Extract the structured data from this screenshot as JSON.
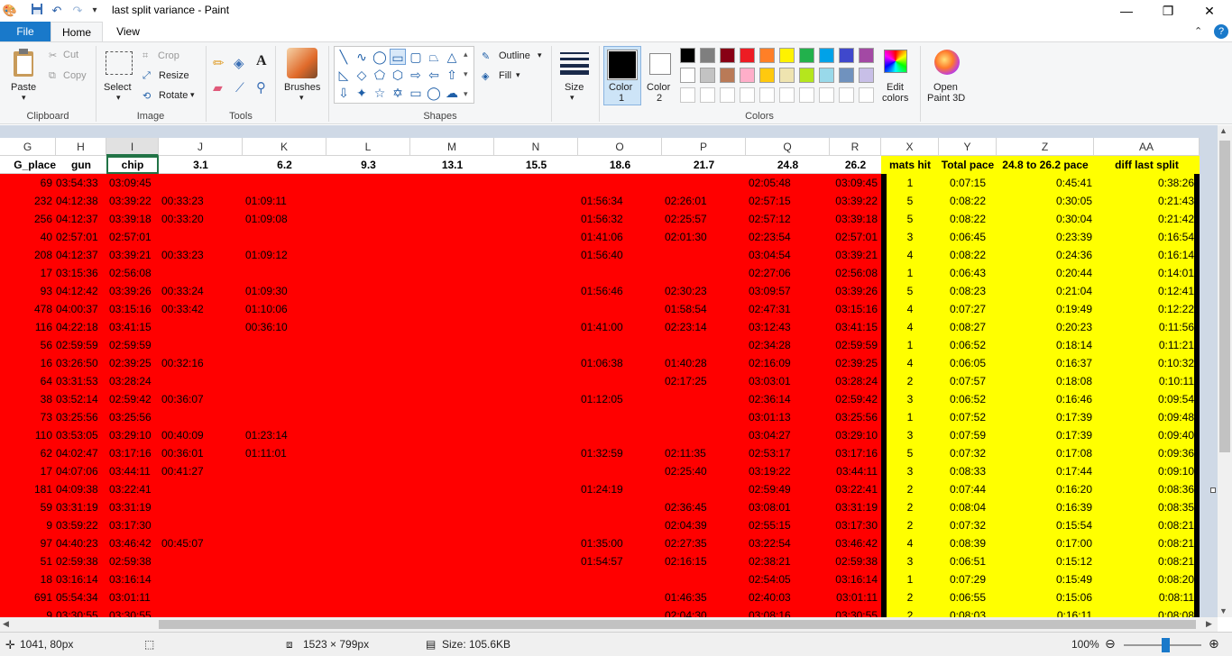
{
  "window": {
    "title": "last split variance - Paint"
  },
  "tabs": {
    "file": "File",
    "home": "Home",
    "view": "View"
  },
  "ribbon": {
    "clipboard": {
      "paste": "Paste",
      "cut": "Cut",
      "copy": "Copy",
      "group": "Clipboard"
    },
    "image": {
      "select": "Select",
      "crop": "Crop",
      "resize": "Resize",
      "rotate": "Rotate",
      "group": "Image"
    },
    "tools": {
      "group": "Tools"
    },
    "brushes": {
      "label": "Brushes"
    },
    "shapes": {
      "outline": "Outline",
      "fill": "Fill",
      "group": "Shapes"
    },
    "size": {
      "label": "Size"
    },
    "colors": {
      "color1_a": "Color",
      "color1_b": "1",
      "color2_a": "Color",
      "color2_b": "2",
      "edit_a": "Edit",
      "edit_b": "colors",
      "group": "Colors",
      "palette_row1": [
        "#000000",
        "#7f7f7f",
        "#880015",
        "#ed1c24",
        "#ff7f27",
        "#fff200",
        "#22b14c",
        "#00a2e8",
        "#3f48cc",
        "#a349a4"
      ],
      "palette_row2": [
        "#ffffff",
        "#c3c3c3",
        "#b97a57",
        "#ffaec9",
        "#ffc90e",
        "#efe4b0",
        "#b5e61d",
        "#99d9ea",
        "#7092be",
        "#c8bfe7"
      ]
    },
    "paint3d": {
      "a": "Open",
      "b": "Paint 3D"
    }
  },
  "sheet": {
    "columns": [
      "G",
      "H",
      "I",
      "J",
      "K",
      "L",
      "M",
      "N",
      "O",
      "P",
      "Q",
      "R",
      "X",
      "Y",
      "Z",
      "AA"
    ],
    "headers": [
      "G_place",
      "gun",
      "chip",
      "3.1",
      "6.2",
      "9.3",
      "13.1",
      "15.5",
      "18.6",
      "21.7",
      "24.8",
      "26.2",
      "mats hit",
      "Total pace",
      "24.8 to 26.2 pace",
      "diff last split"
    ],
    "rows": [
      [
        "69",
        "03:54:33",
        "03:09:45",
        "",
        "",
        "",
        "",
        "",
        "",
        "",
        "02:05:48",
        "03:09:45",
        "1",
        "0:07:15",
        "0:45:41",
        "0:38:26"
      ],
      [
        "232",
        "04:12:38",
        "03:39:22",
        "00:33:23",
        "01:09:11",
        "",
        "",
        "",
        "01:56:34",
        "02:26:01",
        "02:57:15",
        "03:39:22",
        "5",
        "0:08:22",
        "0:30:05",
        "0:21:43"
      ],
      [
        "256",
        "04:12:37",
        "03:39:18",
        "00:33:20",
        "01:09:08",
        "",
        "",
        "",
        "01:56:32",
        "02:25:57",
        "02:57:12",
        "03:39:18",
        "5",
        "0:08:22",
        "0:30:04",
        "0:21:42"
      ],
      [
        "40",
        "02:57:01",
        "02:57:01",
        "",
        "",
        "",
        "",
        "",
        "01:41:06",
        "02:01:30",
        "02:23:54",
        "02:57:01",
        "3",
        "0:06:45",
        "0:23:39",
        "0:16:54"
      ],
      [
        "208",
        "04:12:37",
        "03:39:21",
        "00:33:23",
        "01:09:12",
        "",
        "",
        "",
        "01:56:40",
        "",
        "03:04:54",
        "03:39:21",
        "4",
        "0:08:22",
        "0:24:36",
        "0:16:14"
      ],
      [
        "17",
        "03:15:36",
        "02:56:08",
        "",
        "",
        "",
        "",
        "",
        "",
        "",
        "02:27:06",
        "02:56:08",
        "1",
        "0:06:43",
        "0:20:44",
        "0:14:01"
      ],
      [
        "93",
        "04:12:42",
        "03:39:26",
        "00:33:24",
        "01:09:30",
        "",
        "",
        "",
        "01:56:46",
        "02:30:23",
        "03:09:57",
        "03:39:26",
        "5",
        "0:08:23",
        "0:21:04",
        "0:12:41"
      ],
      [
        "478",
        "04:00:37",
        "03:15:16",
        "00:33:42",
        "01:10:06",
        "",
        "",
        "",
        "",
        "01:58:54",
        "02:47:31",
        "03:15:16",
        "4",
        "0:07:27",
        "0:19:49",
        "0:12:22"
      ],
      [
        "116",
        "04:22:18",
        "03:41:15",
        "",
        "00:36:10",
        "",
        "",
        "",
        "01:41:00",
        "02:23:14",
        "03:12:43",
        "03:41:15",
        "4",
        "0:08:27",
        "0:20:23",
        "0:11:56"
      ],
      [
        "56",
        "02:59:59",
        "02:59:59",
        "",
        "",
        "",
        "",
        "",
        "",
        "",
        "02:34:28",
        "02:59:59",
        "1",
        "0:06:52",
        "0:18:14",
        "0:11:21"
      ],
      [
        "16",
        "03:26:50",
        "02:39:25",
        "00:32:16",
        "",
        "",
        "",
        "",
        "01:06:38",
        "01:40:28",
        "02:16:09",
        "02:39:25",
        "4",
        "0:06:05",
        "0:16:37",
        "0:10:32"
      ],
      [
        "64",
        "03:31:53",
        "03:28:24",
        "",
        "",
        "",
        "",
        "",
        "",
        "02:17:25",
        "03:03:01",
        "03:28:24",
        "2",
        "0:07:57",
        "0:18:08",
        "0:10:11"
      ],
      [
        "38",
        "03:52:14",
        "02:59:42",
        "00:36:07",
        "",
        "",
        "",
        "",
        "01:12:05",
        "",
        "02:36:14",
        "02:59:42",
        "3",
        "0:06:52",
        "0:16:46",
        "0:09:54"
      ],
      [
        "73",
        "03:25:56",
        "03:25:56",
        "",
        "",
        "",
        "",
        "",
        "",
        "",
        "03:01:13",
        "03:25:56",
        "1",
        "0:07:52",
        "0:17:39",
        "0:09:48"
      ],
      [
        "110",
        "03:53:05",
        "03:29:10",
        "00:40:09",
        "01:23:14",
        "",
        "",
        "",
        "",
        "",
        "03:04:27",
        "03:29:10",
        "3",
        "0:07:59",
        "0:17:39",
        "0:09:40"
      ],
      [
        "62",
        "04:02:47",
        "03:17:16",
        "00:36:01",
        "01:11:01",
        "",
        "",
        "",
        "01:32:59",
        "02:11:35",
        "02:53:17",
        "03:17:16",
        "5",
        "0:07:32",
        "0:17:08",
        "0:09:36"
      ],
      [
        "17",
        "04:07:06",
        "03:44:11",
        "00:41:27",
        "",
        "",
        "",
        "",
        "",
        "02:25:40",
        "03:19:22",
        "03:44:11",
        "3",
        "0:08:33",
        "0:17:44",
        "0:09:10"
      ],
      [
        "181",
        "04:09:38",
        "03:22:41",
        "",
        "",
        "",
        "",
        "",
        "01:24:19",
        "",
        "02:59:49",
        "03:22:41",
        "2",
        "0:07:44",
        "0:16:20",
        "0:08:36"
      ],
      [
        "59",
        "03:31:19",
        "03:31:19",
        "",
        "",
        "",
        "",
        "",
        "",
        "02:36:45",
        "03:08:01",
        "03:31:19",
        "2",
        "0:08:04",
        "0:16:39",
        "0:08:35"
      ],
      [
        "9",
        "03:59:22",
        "03:17:30",
        "",
        "",
        "",
        "",
        "",
        "",
        "02:04:39",
        "02:55:15",
        "03:17:30",
        "2",
        "0:07:32",
        "0:15:54",
        "0:08:21"
      ],
      [
        "97",
        "04:40:23",
        "03:46:42",
        "00:45:07",
        "",
        "",
        "",
        "",
        "01:35:00",
        "02:27:35",
        "03:22:54",
        "03:46:42",
        "4",
        "0:08:39",
        "0:17:00",
        "0:08:21"
      ],
      [
        "51",
        "02:59:38",
        "02:59:38",
        "",
        "",
        "",
        "",
        "",
        "01:54:57",
        "02:16:15",
        "02:38:21",
        "02:59:38",
        "3",
        "0:06:51",
        "0:15:12",
        "0:08:21"
      ],
      [
        "18",
        "03:16:14",
        "03:16:14",
        "",
        "",
        "",
        "",
        "",
        "",
        "",
        "02:54:05",
        "03:16:14",
        "1",
        "0:07:29",
        "0:15:49",
        "0:08:20"
      ],
      [
        "691",
        "05:54:34",
        "03:01:11",
        "",
        "",
        "",
        "",
        "",
        "",
        "01:46:35",
        "02:40:03",
        "03:01:11",
        "2",
        "0:06:55",
        "0:15:06",
        "0:08:11"
      ],
      [
        "9",
        "03:30:55",
        "03:30:55",
        "",
        "",
        "",
        "",
        "",
        "",
        "02:04:30",
        "03:08:16",
        "03:30:55",
        "2",
        "0:08:03",
        "0:16:11",
        "0:08:08"
      ]
    ]
  },
  "status": {
    "cursor": "1041, 80px",
    "dimensions": "1523 × 799px",
    "size": "Size: 105.6KB",
    "zoom": "100%"
  }
}
